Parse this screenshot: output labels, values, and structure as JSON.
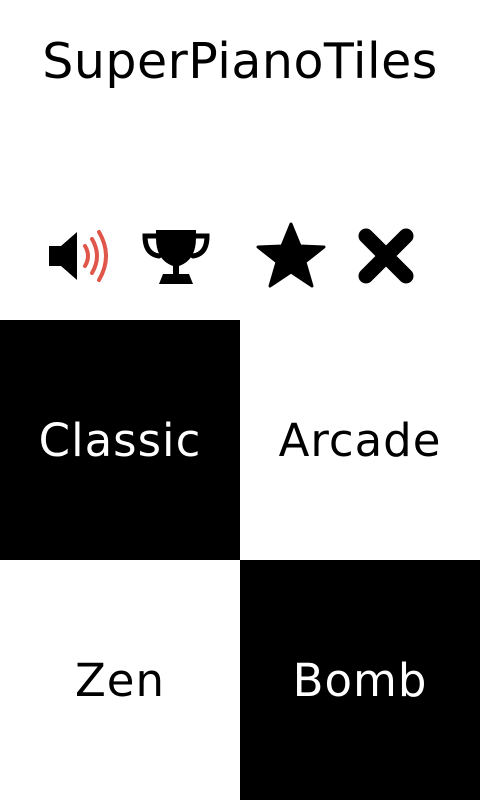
{
  "title": "SuperPianoTiles",
  "toolbar": {
    "icons": [
      "speaker-icon",
      "trophy-icon",
      "star-icon",
      "close-icon"
    ],
    "sound_wave_color": "#e0564a"
  },
  "modes": {
    "classic": "Classic",
    "arcade": "Arcade",
    "zen": "Zen",
    "bomb": "Bomb"
  },
  "colors": {
    "background": "#ffffff",
    "dark_tile": "#000000",
    "light_tile": "#ffffff"
  }
}
